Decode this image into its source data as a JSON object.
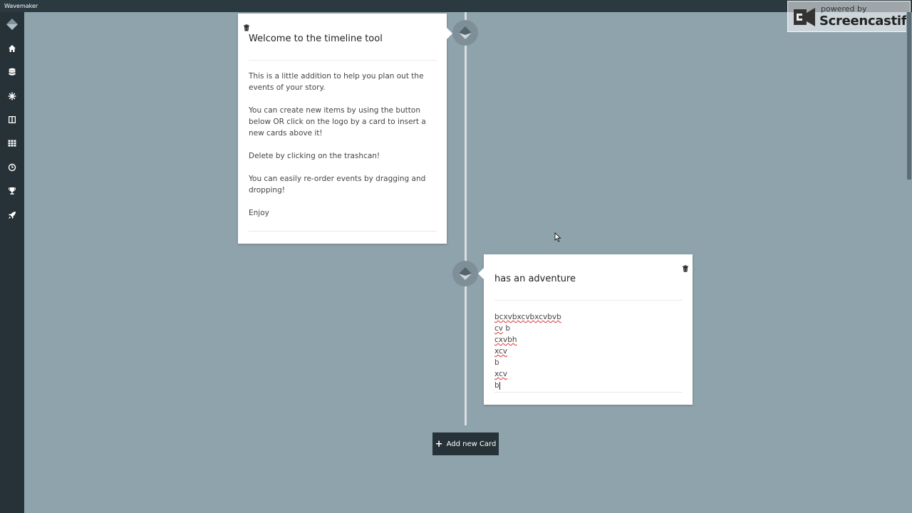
{
  "app": {
    "title": "Wavemaker"
  },
  "sidebar": {
    "items": [
      {
        "icon": "home-icon"
      },
      {
        "icon": "database-icon"
      },
      {
        "icon": "snowflake-icon"
      },
      {
        "icon": "columns-icon"
      },
      {
        "icon": "grid-icon"
      },
      {
        "icon": "clock-icon"
      },
      {
        "icon": "trophy-icon"
      },
      {
        "icon": "rocket-icon"
      }
    ]
  },
  "cards": [
    {
      "title": "Welcome to the timeline tool",
      "paragraphs": [
        "This is a little addition to help you plan out the events of your story.",
        "You can create new items by using the button below OR  click on the logo by a card to insert a new cards above it!",
        "Delete by clicking on the trashcan!",
        "You can easily re-order events by dragging and dropping!",
        "Enjoy"
      ]
    },
    {
      "title": "has an adventure",
      "lines": [
        {
          "text": "bcxvbxcvbxcvbvb",
          "misspelled": true
        },
        {
          "text": "cv",
          "rest": " b",
          "misspelled": true
        },
        {
          "text": "cxvbh",
          "misspelled": true
        },
        {
          "text": "xcv",
          "misspelled": true
        },
        {
          "text": "b",
          "misspelled": false
        },
        {
          "text": "xcv",
          "misspelled": true
        },
        {
          "text": "b",
          "misspelled": false
        }
      ]
    }
  ],
  "add_button": {
    "label": "Add new Card"
  },
  "watermark": {
    "line1": "powered by",
    "line2": "Screencastify"
  },
  "colors": {
    "background": "#8fa3ad",
    "sidebar": "#263238",
    "card": "#ffffff",
    "misspell": "#d33333"
  }
}
